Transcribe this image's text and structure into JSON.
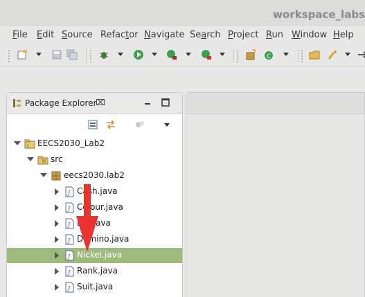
{
  "window": {
    "title": "workspace_labs"
  },
  "menubar": [
    {
      "id": "file",
      "label": "File",
      "u": "F",
      "rest": "ile"
    },
    {
      "id": "edit",
      "label": "Edit",
      "u": "E",
      "rest": "dit"
    },
    {
      "id": "source",
      "label": "Source",
      "u": "S",
      "rest": "ource"
    },
    {
      "id": "refactor",
      "label": "Refactor",
      "u": "",
      "pre": "Refac",
      "mid": "t",
      "post": "or"
    },
    {
      "id": "navigate",
      "label": "Navigate",
      "u": "N",
      "rest": "avigate"
    },
    {
      "id": "search",
      "label": "Search",
      "pre": "Se",
      "mid": "a",
      "post": "rch"
    },
    {
      "id": "project",
      "label": "Project",
      "u": "P",
      "rest": "roject"
    },
    {
      "id": "run",
      "label": "Run",
      "u": "R",
      "rest": "un"
    },
    {
      "id": "window",
      "label": "Window",
      "u": "W",
      "rest": "indow"
    },
    {
      "id": "help",
      "label": "Help",
      "u": "H",
      "rest": "elp"
    }
  ],
  "toolbar": {
    "icons": [
      "new-icon",
      "save-icon",
      "save-all-icon",
      "debug-icon",
      "run-icon",
      "run-coverage-icon",
      "external-tools-icon",
      "new-java-package-icon",
      "new-java-class-icon",
      "open-type-icon",
      "search-icon",
      "more-icon"
    ]
  },
  "package_explorer": {
    "tab_label": "Package Explorer",
    "close_glyph": "⌧",
    "tree": [
      {
        "label": "EECS2030_Lab2",
        "level": 0,
        "expanded": true,
        "icon": "project-icon"
      },
      {
        "label": "src",
        "level": 1,
        "expanded": true,
        "icon": "source-folder-icon"
      },
      {
        "label": "eecs2030.lab2",
        "level": 2,
        "expanded": true,
        "icon": "package-icon"
      },
      {
        "label": "Cash.java",
        "level": 3,
        "expanded": false,
        "icon": "java-file-icon"
      },
      {
        "label": "Colour.java",
        "level": 3,
        "expanded": false,
        "icon": "java-file-icon"
      },
      {
        "label": "Die.java",
        "level": 3,
        "expanded": false,
        "icon": "java-file-icon"
      },
      {
        "label": "Domino.java",
        "level": 3,
        "expanded": false,
        "icon": "java-file-icon"
      },
      {
        "label": "Nickel.java",
        "level": 3,
        "expanded": false,
        "icon": "java-file-icon",
        "selected": true
      },
      {
        "label": "Rank.java",
        "level": 3,
        "expanded": false,
        "icon": "java-file-icon"
      },
      {
        "label": "Suit.java",
        "level": 3,
        "expanded": false,
        "icon": "java-file-icon"
      }
    ]
  },
  "colors": {
    "selection": "#9ebb7d",
    "annotation_arrow": "#e8332f"
  }
}
